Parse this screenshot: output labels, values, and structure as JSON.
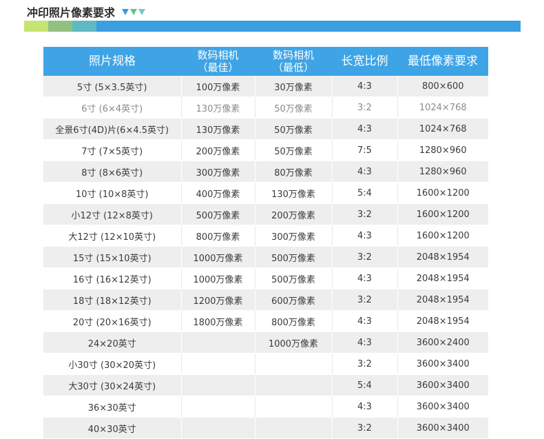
{
  "page": {
    "title": "冲印照片像素要求",
    "icon_names": [
      "triangle-down-blue-icon",
      "triangle-down-green-icon",
      "triangle-down-teal-icon"
    ],
    "colors": {
      "header_bar_segments": [
        "#c6e472",
        "#91c180",
        "#5fb9c0",
        "#3b9ede"
      ],
      "table_header_bg": "#3ea4e6",
      "row_stripe": "#eeeeee"
    }
  },
  "table": {
    "headers": [
      {
        "line1": "照片规格",
        "line2": ""
      },
      {
        "line1": "数码相机",
        "line2": "（最佳）"
      },
      {
        "line1": "数码相机",
        "line2": "（最低）"
      },
      {
        "line1": "长宽比例",
        "line2": ""
      },
      {
        "line1": "最低像素要求",
        "line2": ""
      }
    ],
    "rows": [
      {
        "spec": "5寸 (5×3.5英寸)",
        "best": "100万像素",
        "min": "30万像素",
        "ratio": "4:3",
        "pixels": "800×600"
      },
      {
        "spec": "6寸 (6×4英寸)",
        "best": "130万像素",
        "min": "50万像素",
        "ratio": "3:2",
        "pixels": "1024×768"
      },
      {
        "spec": "全景6寸(4D)片(6×4.5英寸)",
        "best": "130万像素",
        "min": "50万像素",
        "ratio": "4:3",
        "pixels": "1024×768"
      },
      {
        "spec": "7寸 (7×5英寸)",
        "best": "200万像素",
        "min": "50万像素",
        "ratio": "7:5",
        "pixels": "1280×960"
      },
      {
        "spec": "8寸 (8×6英寸)",
        "best": "300万像素",
        "min": "80万像素",
        "ratio": "4:3",
        "pixels": "1280×960"
      },
      {
        "spec": "10寸 (10×8英寸)",
        "best": "400万像素",
        "min": "130万像素",
        "ratio": "5:4",
        "pixels": "1600×1200"
      },
      {
        "spec": "小12寸 (12×8英寸)",
        "best": "500万像素",
        "min": "200万像素",
        "ratio": "3:2",
        "pixels": "1600×1200"
      },
      {
        "spec": "大12寸 (12×10英寸)",
        "best": "800万像素",
        "min": "300万像素",
        "ratio": "4:3",
        "pixels": "1600×1200"
      },
      {
        "spec": "15寸 (15×10英寸)",
        "best": "1000万像素",
        "min": "500万像素",
        "ratio": "3:2",
        "pixels": "2048×1954"
      },
      {
        "spec": "16寸 (16×12英寸)",
        "best": "1000万像素",
        "min": "500万像素",
        "ratio": "4:3",
        "pixels": "2048×1954"
      },
      {
        "spec": "18寸 (18×12英寸)",
        "best": "1200万像素",
        "min": "600万像素",
        "ratio": "3:2",
        "pixels": "2048×1954"
      },
      {
        "spec": "20寸 (20×16英寸)",
        "best": "1800万像素",
        "min": "800万像素",
        "ratio": "4:3",
        "pixels": "2048×1954"
      },
      {
        "spec": "24×20英寸",
        "best": "",
        "min": "1000万像素",
        "ratio": "4:3",
        "pixels": "3600×2400"
      },
      {
        "spec": "小30寸 (30×20英寸)",
        "best": "",
        "min": "",
        "ratio": "3:2",
        "pixels": "3600×3400"
      },
      {
        "spec": "大30寸 (30×24英寸)",
        "best": "",
        "min": "",
        "ratio": "5:4",
        "pixels": "3600×3400"
      },
      {
        "spec": "36×30英寸",
        "best": "",
        "min": "",
        "ratio": "4:3",
        "pixels": "3600×3400"
      },
      {
        "spec": "40×30英寸",
        "best": "",
        "min": "",
        "ratio": "3:2",
        "pixels": "3600×3400"
      }
    ]
  }
}
